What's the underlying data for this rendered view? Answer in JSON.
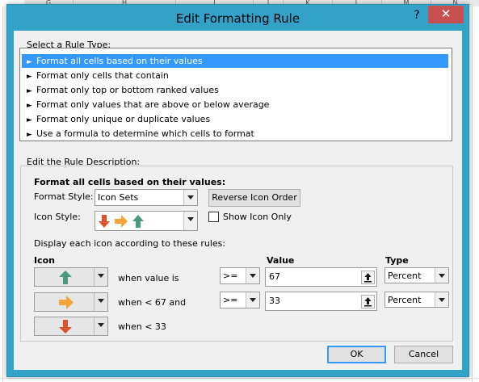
{
  "spreadsheet": {
    "column_letters": [
      "G",
      "H",
      "I",
      "J",
      "K",
      "L",
      "M",
      "N"
    ]
  },
  "dialog": {
    "title": "Edit Formatting Rule",
    "help_label": "?",
    "close_label": "✕",
    "select_rule_type_label": "Select a Rule Type:",
    "rule_types": [
      "Format all cells based on their values",
      "Format only cells that contain",
      "Format only top or bottom ranked values",
      "Format only values that are above or below average",
      "Format only unique or duplicate values",
      "Use a formula to determine which cells to format"
    ],
    "selected_rule_index": 0,
    "edit_rule_description_label": "Edit the Rule Description:",
    "description": {
      "heading": "Format all cells based on their values:",
      "format_style_label": "Format Style:",
      "format_style_value": "Icon Sets",
      "reverse_icon_order_label": "Reverse Icon Order",
      "icon_style_label": "Icon Style:",
      "show_icon_only_label": "Show Icon Only",
      "show_icon_only_checked": false,
      "display_rules_label": "Display each icon according to these rules:",
      "columns": {
        "icon": "Icon",
        "value": "Value",
        "type": "Type"
      },
      "rules": [
        {
          "icon": "green-up-arrow-icon",
          "condition": "when value is",
          "operator": ">=",
          "value": "67",
          "type": "Percent"
        },
        {
          "icon": "yellow-right-arrow-icon",
          "condition": "when < 67 and",
          "operator": ">=",
          "value": "33",
          "type": "Percent"
        },
        {
          "icon": "red-down-arrow-icon",
          "condition": "when < 33"
        }
      ]
    },
    "ok_label": "OK",
    "cancel_label": "Cancel"
  },
  "colors": {
    "title_bar": "#33a2c8",
    "close_button": "#c75050",
    "selection": "#3399ff",
    "icon_green": "#4a9a7c",
    "icon_yellow": "#f3a53a",
    "icon_red": "#d9542c"
  }
}
